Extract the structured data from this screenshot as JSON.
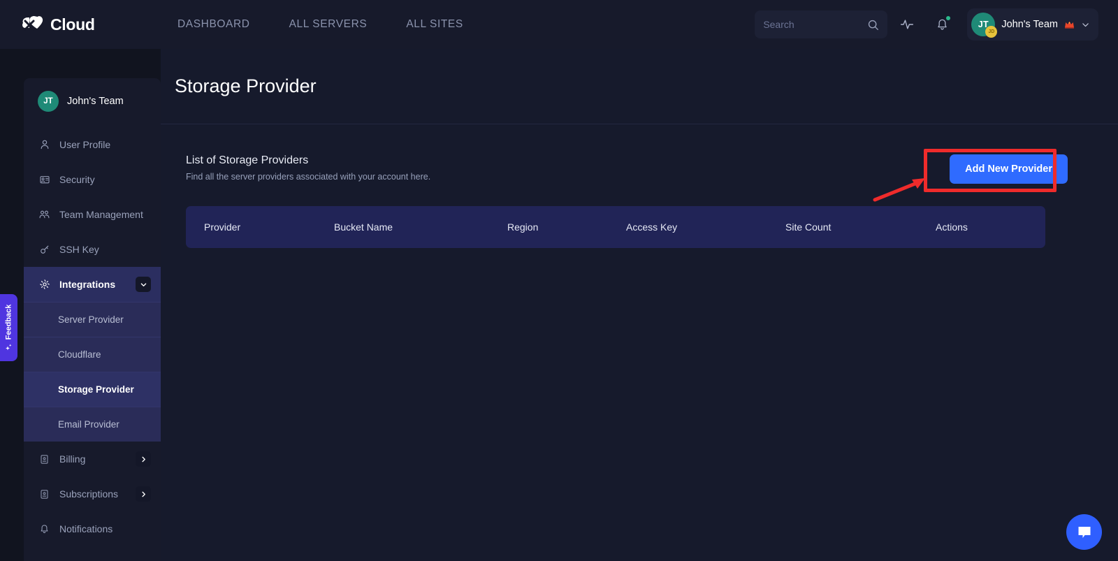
{
  "topnav": {
    "brand": "Cloud",
    "brand_icon": "cloud-logo-icon",
    "links": [
      {
        "label": "DASHBOARD",
        "name": "nav-link-dashboard"
      },
      {
        "label": "ALL SERVERS",
        "name": "nav-link-all-servers"
      },
      {
        "label": "ALL SITES",
        "name": "nav-link-all-sites"
      }
    ],
    "search": {
      "placeholder": "Search",
      "value": "",
      "icon": "search-icon"
    },
    "activity_icon": "activity-pulse-icon",
    "notifications_icon": "bell-icon",
    "user": {
      "avatar_initials": "JT",
      "avatar_badge": "JD",
      "name": "John's Team",
      "crown_icon": "crown-icon",
      "chevron_icon": "chevron-down-icon"
    }
  },
  "sidebar": {
    "team": {
      "initials": "JT",
      "name": "John's Team"
    },
    "items": [
      {
        "label": "User Profile",
        "icon": "user-icon",
        "name": "sidebar-item-user-profile",
        "active": false,
        "trailing": ""
      },
      {
        "label": "Security",
        "icon": "security-badge-icon",
        "name": "sidebar-item-security",
        "active": false,
        "trailing": ""
      },
      {
        "label": "Team Management",
        "icon": "team-people-icon",
        "name": "sidebar-item-team-management",
        "active": false,
        "trailing": ""
      },
      {
        "label": "SSH Key",
        "icon": "key-icon",
        "name": "sidebar-item-ssh-key",
        "active": false,
        "trailing": ""
      },
      {
        "label": "Integrations",
        "icon": "gear-icon",
        "name": "sidebar-item-integrations",
        "active": true,
        "trailing": "chevron-down-icon"
      }
    ],
    "submenu": [
      {
        "label": "Server Provider",
        "name": "sidebar-subitem-server-provider",
        "active": false
      },
      {
        "label": "Cloudflare",
        "name": "sidebar-subitem-cloudflare",
        "active": false
      },
      {
        "label": "Storage Provider",
        "name": "sidebar-subitem-storage-provider",
        "active": true
      },
      {
        "label": "Email Provider",
        "name": "sidebar-subitem-email-provider",
        "active": false
      }
    ],
    "items_bottom": [
      {
        "label": "Billing",
        "icon": "billing-icon",
        "name": "sidebar-item-billing",
        "trailing": "chevron-right-icon"
      },
      {
        "label": "Subscriptions",
        "icon": "subscription-icon",
        "name": "sidebar-item-subscriptions",
        "trailing": "chevron-right-icon"
      },
      {
        "label": "Notifications",
        "icon": "bell-icon",
        "name": "sidebar-item-notifications",
        "trailing": ""
      }
    ]
  },
  "main": {
    "page_title": "Storage Provider",
    "list_title": "List of Storage Providers",
    "list_subtitle": "Find all the server providers associated with your account here.",
    "add_button": "Add New Provider",
    "table": {
      "columns": [
        "Provider",
        "Bucket Name",
        "Region",
        "Access Key",
        "Site Count",
        "Actions"
      ],
      "rows": []
    }
  },
  "feedback": {
    "label": "Feedback",
    "icon": "sparkle-icon"
  },
  "chat": {
    "icon": "chat-bubble-icon"
  },
  "colors": {
    "page_bg": "#11141f",
    "panel_bg": "#161a2c",
    "nav_bg": "#171a2b",
    "accent_blue": "#2f6bff",
    "table_header": "#212457",
    "sidebar_active": "#2b2e60",
    "submenu_bg": "#2a2c58",
    "annotation_red": "#ef2b2b",
    "avatar_teal": "#1f8a77",
    "feedback_purple": "#4f35e0"
  }
}
